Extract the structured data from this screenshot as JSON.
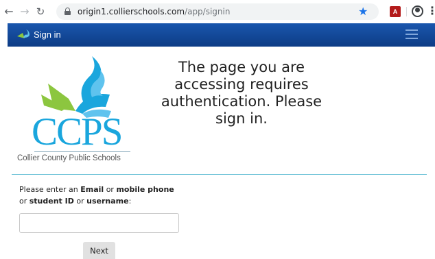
{
  "browser": {
    "url_host": "origin1.collierschools.com",
    "url_path": "/app/signin",
    "pdf_extension_label": "A",
    "icons": [
      "back-arrow-icon",
      "forward-arrow-icon",
      "reload-icon",
      "lock-icon",
      "star-icon",
      "pdf-extension-icon",
      "account-icon",
      "menu-dots-icon"
    ]
  },
  "header": {
    "title": "Sign in",
    "color": "#1a56ad"
  },
  "logo": {
    "letters": "CCPS",
    "school_name": "Collier County Public Schools",
    "accent_color": "#1aa6dd",
    "green_color": "#8cc63f"
  },
  "auth_message": "The page you are accessing requires authentication. Please sign in.",
  "form": {
    "prompt_parts": {
      "t1": "Please enter an ",
      "b1": "Email",
      "t2": " or ",
      "b2": "mobile phone",
      "t3": " or ",
      "b3": "student ID",
      "t4": " or ",
      "b4": "username",
      "t5": ":"
    },
    "input_value": "",
    "next_label": "Next"
  }
}
